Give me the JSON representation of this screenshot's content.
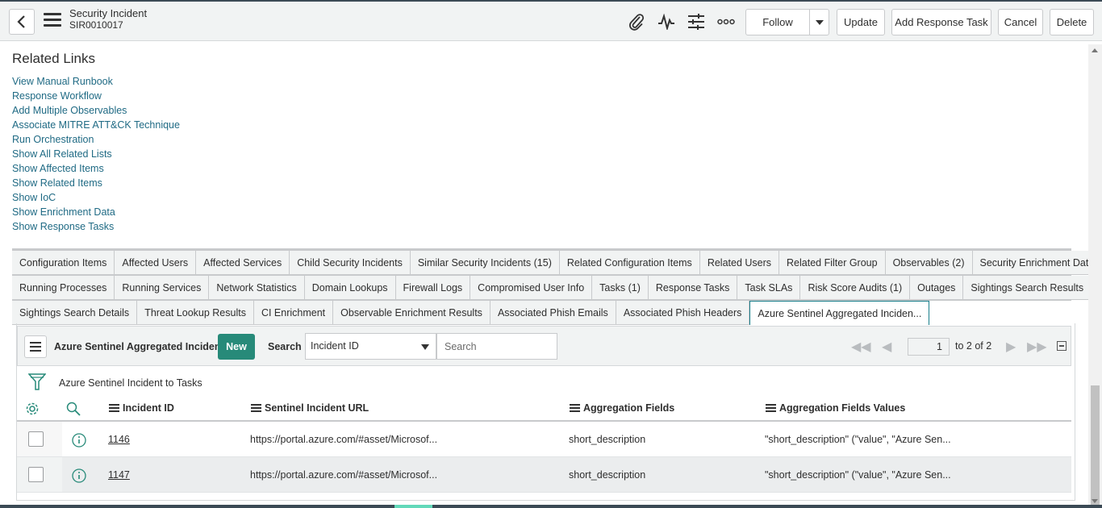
{
  "header": {
    "title": "Security Incident",
    "number": "SIR0010017",
    "buttons": {
      "follow": "Follow",
      "update": "Update",
      "add_response_task": "Add Response Task",
      "cancel": "Cancel",
      "delete": "Delete"
    },
    "icons": [
      "back-icon",
      "menu-icon",
      "paperclip-icon",
      "activity-icon",
      "settings-sliders-icon",
      "more-icon",
      "caret-down-icon"
    ]
  },
  "related_links": {
    "title": "Related Links",
    "links": [
      "View Manual Runbook",
      "Response Workflow",
      "Add Multiple Observables",
      "Associate MITRE ATT&CK Technique",
      "Run Orchestration",
      "Show All Related Lists",
      "Show Affected Items",
      "Show Related Items",
      "Show IoC",
      "Show Enrichment Data",
      "Show Response Tasks"
    ]
  },
  "tabs": {
    "row1": [
      "Configuration Items",
      "Affected Users",
      "Affected Services",
      "Child Security Incidents",
      "Similar Security Incidents (15)",
      "Related Configuration Items",
      "Related Users",
      "Related Filter Group",
      "Observables (2)",
      "Security Enrichment Data"
    ],
    "row2": [
      "Running Processes",
      "Running Services",
      "Network Statistics",
      "Domain Lookups",
      "Firewall Logs",
      "Compromised User Info",
      "Tasks (1)",
      "Response Tasks",
      "Task SLAs",
      "Risk Score Audits (1)",
      "Outages",
      "Sightings Search Results"
    ],
    "row3": [
      "Sightings Search Details",
      "Threat Lookup Results",
      "CI Enrichment",
      "Observable Enrichment Results",
      "Associated Phish Emails",
      "Associated Phish Headers",
      "Azure Sentinel Aggregated Inciden..."
    ],
    "active": "Azure Sentinel Aggregated Inciden..."
  },
  "list": {
    "title": "Azure Sentinel Aggregated Incidents",
    "new_label": "New",
    "search_label": "Search",
    "search_field": "Incident ID",
    "search_placeholder": "Search",
    "page": "1",
    "page_of": "to 2 of 2",
    "filter_text": "Azure Sentinel Incident to Tasks",
    "columns": [
      "Incident ID",
      "Sentinel Incident URL",
      "Aggregation Fields",
      "Aggregation Fields Values"
    ],
    "rows": [
      {
        "id": "1146",
        "url": "https://portal.azure.com/#asset/Microsof...",
        "fields": "short_description",
        "values": "\"short_description\" (\"value\", \"Azure Sen..."
      },
      {
        "id": "1147",
        "url": "https://portal.azure.com/#asset/Microsof...",
        "fields": "short_description",
        "values": "\"short_description\" (\"value\", \"Azure Sen..."
      }
    ]
  }
}
